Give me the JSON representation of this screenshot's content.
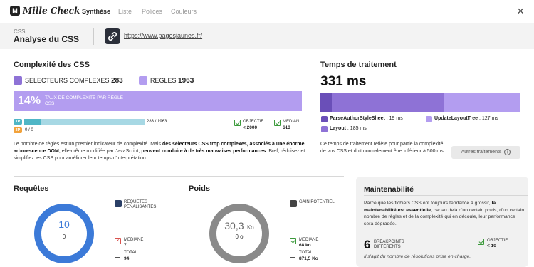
{
  "app": {
    "logo": "Mille Check",
    "logo_mark": "M"
  },
  "nav": {
    "tabs": [
      "Synthèse",
      "Liste",
      "Polices",
      "Couleurs"
    ],
    "active": "Synthèse"
  },
  "header": {
    "subtitle": "CSS",
    "title": "Analyse du CSS",
    "url": "https://www.pagesjaunes.fr/"
  },
  "complexity": {
    "title": "Complexité des CSS",
    "complex_label": "SELECTEURS COMPLEXES",
    "complex_value": "283",
    "rules_label": "REGLES",
    "rules_value": "1963",
    "pct": "14%",
    "pct_label": "TAUX DE COMPLEXITÉ PAR RÈGLE CSS",
    "bar_1p_label": "1P",
    "bar_1p_value": "283 / 1963",
    "bar_1p_fraction": 0.144,
    "bar_3p_label": "3P",
    "bar_3p_value": "0 / 0",
    "objective_label": "OBJECTIF",
    "objective_value": "< 2000",
    "median_label": "MEDIAN",
    "median_value": "613",
    "desc_1": "Le nombre de règles est un premier indicateur de complexité. Mais ",
    "desc_b1": "des sélecteurs CSS trop complexes, associés à une énorme arborescence DOM",
    "desc_2": ", elle-même modifiée par JavaScript, ",
    "desc_b2": "peuvent conduire à de très mauvaises performances",
    "desc_3": ". Bref, réduisez et simplifiez les CSS pour améliorer leur temps d'interprétation."
  },
  "processing": {
    "title": "Temps de traitement",
    "total": "331 ms",
    "segments": [
      {
        "name": "ParseAuthorStyleSheet",
        "value": "19 ms",
        "ms": 19,
        "color": "#6a4fb8"
      },
      {
        "name": "UpdateLayoutTree",
        "value": "127 ms",
        "ms": 127,
        "color": "#b39df0"
      },
      {
        "name": "Layout",
        "value": "185 ms",
        "ms": 185,
        "color": "#8e72d6"
      }
    ],
    "desc": "Ce temps de traitement reflète pour partie la complexité de vos CSS et doit normalement être inférieur à 500 ms.",
    "button": "Autres traitements"
  },
  "requetes": {
    "title": "Requêtes",
    "value": "10",
    "sub": "0",
    "penal_label": "REQUETES PENALISANTES",
    "median_label": "MEDIANE",
    "median_value": "7",
    "total_label": "TOTAL",
    "total_value": "94"
  },
  "poids": {
    "title": "Poids",
    "value": "30,3",
    "unit": "Ko",
    "sub": "0 o",
    "gain_label": "GAIN POTENTIEL",
    "median_label": "MEDIANE",
    "median_value": "68 ko",
    "total_label": "TOTAL",
    "total_value": "871,5 Ko"
  },
  "maintenabilite": {
    "title": "Maintenabilité",
    "desc_1": "Parce que les fichiers CSS ont toujours tendance à grossir, ",
    "desc_b": "la maintenabilité est essentielle",
    "desc_2": ", car au delà d'un certain poids, d'un certain nombre de règles et de la complexité qui en découle, leur performance sera dégradée.",
    "breakpoints_value": "6",
    "breakpoints_label": "BREAKPOINTS DIFFÉRENTS",
    "objective_label": "OBJECTIF",
    "objective_value": "< 10",
    "footnote": "Il s'agit du nombre de résolutions prise en charge."
  },
  "colors": {
    "primary": "#8e72d6",
    "light": "#b39df0",
    "dark": "#6a4fb8",
    "blue": "#3c7ad8",
    "gray": "#8a8a8a",
    "teal": "#4fb6c6",
    "orange": "#f2a23a"
  }
}
